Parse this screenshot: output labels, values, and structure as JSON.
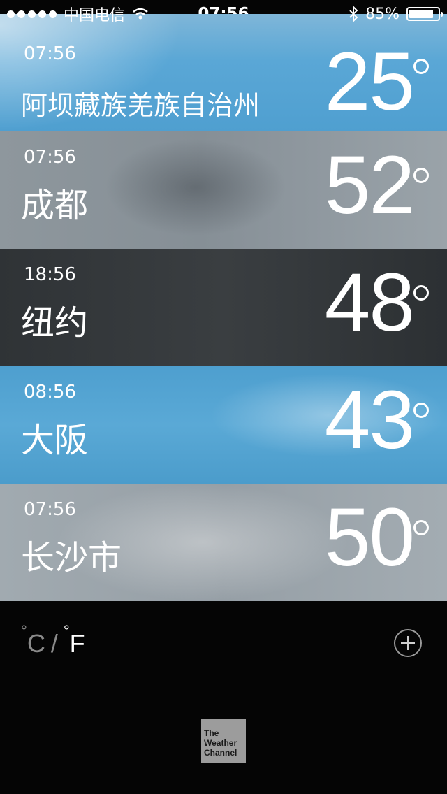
{
  "status_bar": {
    "carrier": "中国电信",
    "time": "07:56",
    "battery_percent": "85%",
    "battery_level": 0.85,
    "icons": [
      "signal-dots-icon",
      "wifi-icon",
      "bluetooth-icon",
      "battery-icon"
    ]
  },
  "cities": [
    {
      "time": "07:56",
      "name": "阿坝藏族羌族自治州",
      "temp": "25"
    },
    {
      "time": "07:56",
      "name": "成都",
      "temp": "52"
    },
    {
      "time": "18:56",
      "name": "纽约",
      "temp": "48"
    },
    {
      "time": "08:56",
      "name": "大阪",
      "temp": "43"
    },
    {
      "time": "07:56",
      "name": "长沙市",
      "temp": "50"
    }
  ],
  "units": {
    "celsius": "C",
    "separator": "/",
    "fahrenheit": "F",
    "selected": "F"
  },
  "footer": {
    "logo_line1": "The",
    "logo_line2": "Weather",
    "logo_line3": "Channel"
  },
  "colors": {
    "sky_blue": "#5aa7d6",
    "overcast_gray": "#8e979d",
    "night_dark": "#33373a",
    "background": "#050505"
  }
}
